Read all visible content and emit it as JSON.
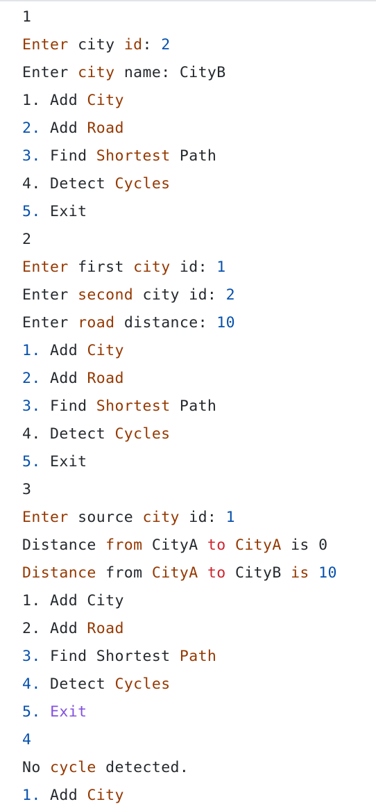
{
  "colors": {
    "default": "#24292e",
    "keyword": "#953800",
    "number": "#0550ae",
    "red": "#cf222e",
    "purple": "#8250df"
  },
  "lines": [
    {
      "tokens": [
        {
          "t": "1",
          "c": "default"
        }
      ]
    },
    {
      "tokens": [
        {
          "t": "Enter",
          "c": "keyword"
        },
        {
          "t": " city ",
          "c": "default"
        },
        {
          "t": "id",
          "c": "keyword"
        },
        {
          "t": ": ",
          "c": "default"
        },
        {
          "t": "2",
          "c": "number"
        }
      ]
    },
    {
      "tokens": [
        {
          "t": "Enter ",
          "c": "default"
        },
        {
          "t": "city",
          "c": "keyword"
        },
        {
          "t": " name: CityB",
          "c": "default"
        }
      ]
    },
    {
      "tokens": [
        {
          "t": "1. Add ",
          "c": "default"
        },
        {
          "t": "City",
          "c": "keyword"
        }
      ]
    },
    {
      "tokens": [
        {
          "t": "2.",
          "c": "number"
        },
        {
          "t": " Add ",
          "c": "default"
        },
        {
          "t": "Road",
          "c": "keyword"
        }
      ]
    },
    {
      "tokens": [
        {
          "t": "3.",
          "c": "number"
        },
        {
          "t": " Find ",
          "c": "default"
        },
        {
          "t": "Shortest",
          "c": "keyword"
        },
        {
          "t": " Path",
          "c": "default"
        }
      ]
    },
    {
      "tokens": [
        {
          "t": "4. Detect ",
          "c": "default"
        },
        {
          "t": "Cycles",
          "c": "keyword"
        }
      ]
    },
    {
      "tokens": [
        {
          "t": "5.",
          "c": "number"
        },
        {
          "t": " Exit",
          "c": "default"
        }
      ]
    },
    {
      "tokens": [
        {
          "t": "2",
          "c": "default"
        }
      ]
    },
    {
      "tokens": [
        {
          "t": "Enter",
          "c": "keyword"
        },
        {
          "t": " first ",
          "c": "default"
        },
        {
          "t": "city",
          "c": "keyword"
        },
        {
          "t": " id: ",
          "c": "default"
        },
        {
          "t": "1",
          "c": "number"
        }
      ]
    },
    {
      "tokens": [
        {
          "t": "Enter ",
          "c": "default"
        },
        {
          "t": "second",
          "c": "keyword"
        },
        {
          "t": " city id: ",
          "c": "default"
        },
        {
          "t": "2",
          "c": "number"
        }
      ]
    },
    {
      "tokens": [
        {
          "t": "Enter ",
          "c": "default"
        },
        {
          "t": "road",
          "c": "keyword"
        },
        {
          "t": " distance: ",
          "c": "default"
        },
        {
          "t": "10",
          "c": "number"
        }
      ]
    },
    {
      "tokens": [
        {
          "t": "1.",
          "c": "number"
        },
        {
          "t": " Add ",
          "c": "default"
        },
        {
          "t": "City",
          "c": "keyword"
        }
      ]
    },
    {
      "tokens": [
        {
          "t": "2.",
          "c": "number"
        },
        {
          "t": " Add ",
          "c": "default"
        },
        {
          "t": "Road",
          "c": "keyword"
        }
      ]
    },
    {
      "tokens": [
        {
          "t": "3.",
          "c": "number"
        },
        {
          "t": " Find ",
          "c": "default"
        },
        {
          "t": "Shortest",
          "c": "keyword"
        },
        {
          "t": " Path",
          "c": "default"
        }
      ]
    },
    {
      "tokens": [
        {
          "t": "4. Detect ",
          "c": "default"
        },
        {
          "t": "Cycles",
          "c": "keyword"
        }
      ]
    },
    {
      "tokens": [
        {
          "t": "5.",
          "c": "number"
        },
        {
          "t": " Exit",
          "c": "default"
        }
      ]
    },
    {
      "tokens": [
        {
          "t": "3",
          "c": "default"
        }
      ]
    },
    {
      "tokens": [
        {
          "t": "Enter",
          "c": "keyword"
        },
        {
          "t": " source ",
          "c": "default"
        },
        {
          "t": "city",
          "c": "keyword"
        },
        {
          "t": " id: ",
          "c": "default"
        },
        {
          "t": "1",
          "c": "number"
        }
      ]
    },
    {
      "tokens": [
        {
          "t": "Distance ",
          "c": "default"
        },
        {
          "t": "from",
          "c": "keyword"
        },
        {
          "t": " CityA ",
          "c": "default"
        },
        {
          "t": "to",
          "c": "red"
        },
        {
          "t": " ",
          "c": "default"
        },
        {
          "t": "CityA",
          "c": "keyword"
        },
        {
          "t": " is 0",
          "c": "default"
        }
      ]
    },
    {
      "tokens": [
        {
          "t": "Distance",
          "c": "keyword"
        },
        {
          "t": " from ",
          "c": "default"
        },
        {
          "t": "CityA",
          "c": "keyword"
        },
        {
          "t": " ",
          "c": "default"
        },
        {
          "t": "to",
          "c": "red"
        },
        {
          "t": " CityB ",
          "c": "default"
        },
        {
          "t": "is",
          "c": "keyword"
        },
        {
          "t": " ",
          "c": "default"
        },
        {
          "t": "10",
          "c": "number"
        }
      ]
    },
    {
      "tokens": [
        {
          "t": "1. Add City",
          "c": "default"
        }
      ]
    },
    {
      "tokens": [
        {
          "t": "2. Add ",
          "c": "default"
        },
        {
          "t": "Road",
          "c": "keyword"
        }
      ]
    },
    {
      "tokens": [
        {
          "t": "3.",
          "c": "number"
        },
        {
          "t": " Find Shortest ",
          "c": "default"
        },
        {
          "t": "Path",
          "c": "keyword"
        }
      ]
    },
    {
      "tokens": [
        {
          "t": "4.",
          "c": "number"
        },
        {
          "t": " Detect ",
          "c": "default"
        },
        {
          "t": "Cycles",
          "c": "keyword"
        }
      ]
    },
    {
      "tokens": [
        {
          "t": "5.",
          "c": "number"
        },
        {
          "t": " ",
          "c": "default"
        },
        {
          "t": "Exit",
          "c": "purple"
        }
      ]
    },
    {
      "tokens": [
        {
          "t": "4",
          "c": "number"
        }
      ]
    },
    {
      "tokens": [
        {
          "t": "No ",
          "c": "default"
        },
        {
          "t": "cycle",
          "c": "keyword"
        },
        {
          "t": " detected.",
          "c": "default"
        }
      ]
    },
    {
      "tokens": [
        {
          "t": "1.",
          "c": "number"
        },
        {
          "t": " Add ",
          "c": "default"
        },
        {
          "t": "City",
          "c": "keyword"
        }
      ]
    }
  ]
}
